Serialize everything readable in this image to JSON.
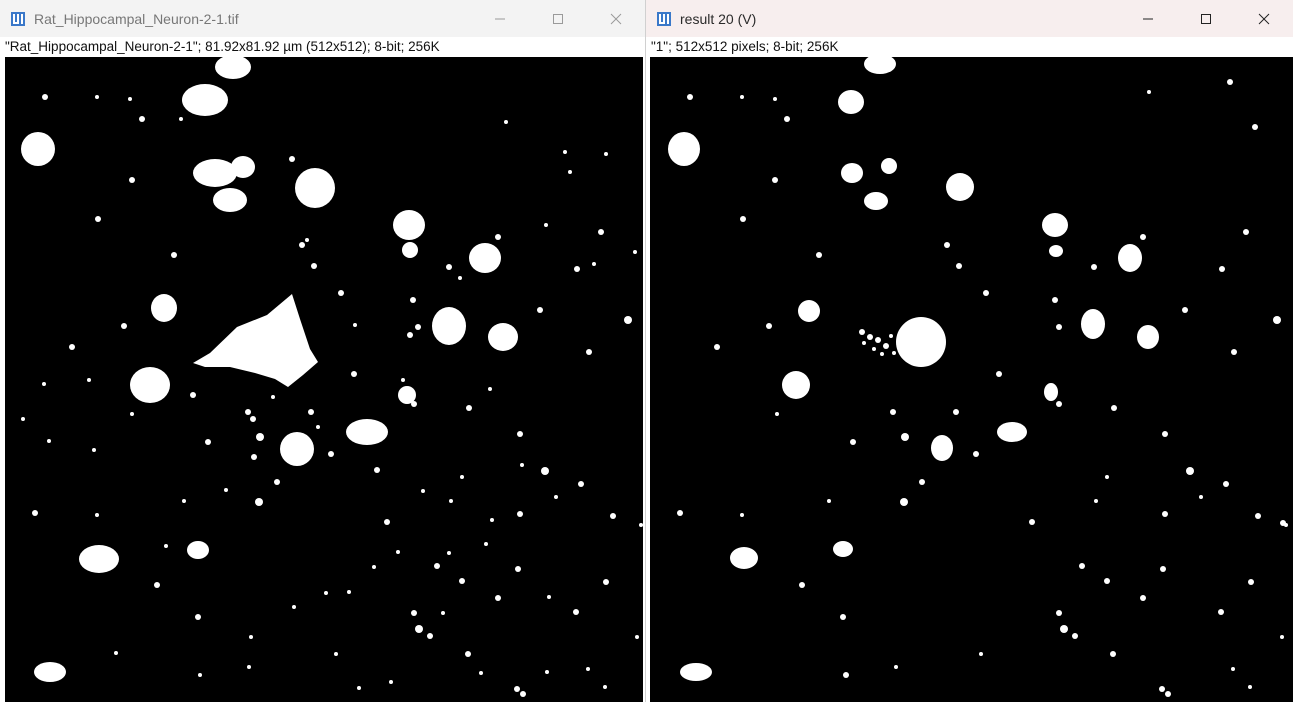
{
  "left_window": {
    "title": "Rat_Hippocampal_Neuron-2-1.tif",
    "info": "\"Rat_Hippocampal_Neuron-2-1\"; 81.92x81.92 µm (512x512); 8-bit; 256K",
    "icon": "imagej-icon"
  },
  "right_window": {
    "title": "result 20 (V)",
    "info": "\"1\"; 512x512 pixels; 8-bit; 256K",
    "icon": "imagej-icon"
  },
  "controls": [
    "minimize-icon",
    "maximize-icon",
    "close-icon"
  ],
  "colors": {
    "left_titlebar": "#f3f3f3",
    "right_titlebar": "#f7eeee",
    "image_background": "#000000",
    "foreground_blobs": "#ffffff"
  }
}
